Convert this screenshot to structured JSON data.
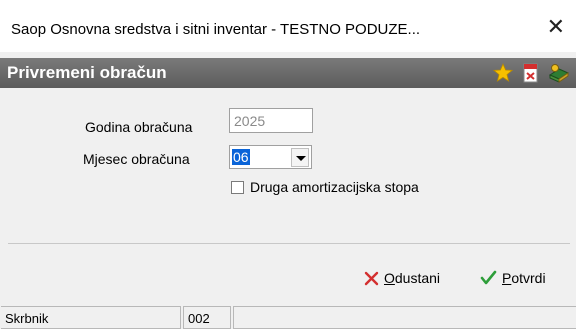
{
  "window": {
    "title": "Saop Osnovna sredstva i sitni inventar  - TESTNO PODUZE...",
    "close_glyph": "✕"
  },
  "panel": {
    "title": "Privremeni obračun",
    "tools": [
      {
        "icon": "star-icon",
        "color": "#f4b400"
      },
      {
        "icon": "pdf-document-icon",
        "color": "#d32f2f"
      },
      {
        "icon": "books-help-icon",
        "color": "#2e7d32"
      }
    ]
  },
  "form": {
    "year_label": "Godina obračuna",
    "year_value": "2025",
    "month_label": "Mjesec obračuna",
    "month_value": "06",
    "checkbox_label": "Druga amortizacijska stopa",
    "checkbox_checked": false
  },
  "actions": {
    "cancel_u": "O",
    "cancel_rest": "dustani",
    "confirm_u": "P",
    "confirm_rest": "otvrdi"
  },
  "status": {
    "user": "Skrbnik",
    "code": "002",
    "extra": ""
  },
  "colors": {
    "panel_bar": "#666666",
    "selection": "#0a64d8",
    "cancel": "#d32f2f",
    "confirm": "#2e9e3a"
  }
}
